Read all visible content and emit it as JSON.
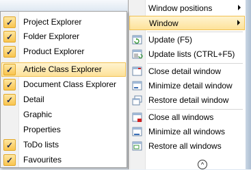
{
  "submenu": {
    "items": [
      {
        "label": "Project Explorer",
        "checked": true
      },
      {
        "label": "Folder Explorer",
        "checked": true
      },
      {
        "label": "Product Explorer",
        "checked": true
      },
      {
        "label": "Article Class Explorer",
        "checked": true,
        "highlighted": true
      },
      {
        "label": "Document Class Explorer",
        "checked": true
      },
      {
        "label": "Detail",
        "checked": true
      },
      {
        "label": "Graphic",
        "checked": false
      },
      {
        "label": "Properties",
        "checked": false
      },
      {
        "label": "ToDo lists",
        "checked": true
      },
      {
        "label": "Favourites",
        "checked": true
      }
    ]
  },
  "mainmenu": {
    "window_positions": "Window positions",
    "window": "Window",
    "update": "Update (F5)",
    "update_lists": "Update lists (CTRL+F5)",
    "close_detail": "Close detail window",
    "minimize_detail": "Minimize detail window",
    "restore_detail": "Restore detail window",
    "close_all": "Close all windows",
    "minimize_all": "Minimize all windows",
    "restore_all": "Restore all windows"
  },
  "colors": {
    "highlight": "#fde29a",
    "check": "#f9c44f",
    "icon_green": "#3a9a3a",
    "icon_red": "#d02020",
    "icon_blue": "#3b6fb6"
  },
  "icons": {
    "check": "checkmark-icon",
    "submenu_arrow": "chevron-right-icon",
    "update": "refresh-icon",
    "update_lists": "refresh-list-icon",
    "close_detail": "close-window-icon",
    "minimize_detail": "minimize-window-icon",
    "restore_detail": "restore-window-icon",
    "close_all": "close-all-icon",
    "minimize_all": "minimize-all-icon",
    "restore_all": "restore-all-icon",
    "scroll_up": "scroll-up-icon"
  }
}
